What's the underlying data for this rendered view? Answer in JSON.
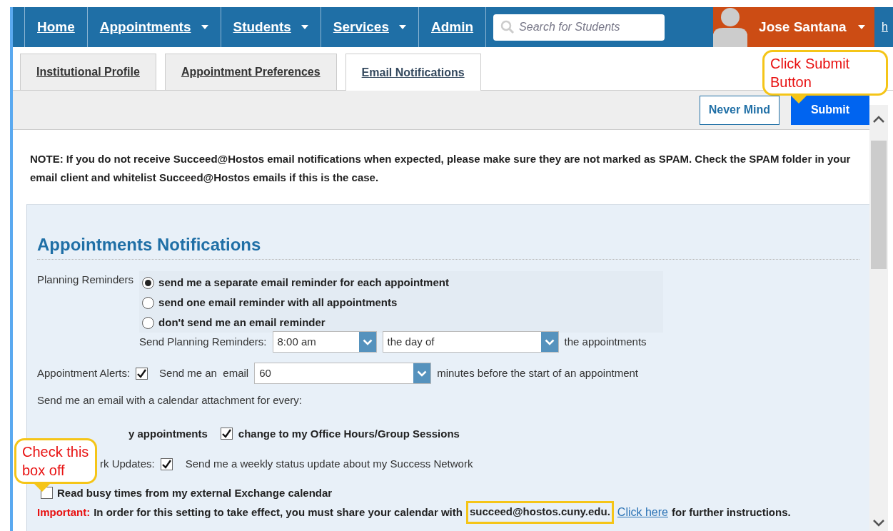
{
  "nav": {
    "items": [
      {
        "label": "Home",
        "dropdown": false
      },
      {
        "label": "Appointments",
        "dropdown": true
      },
      {
        "label": "Students",
        "dropdown": true
      },
      {
        "label": "Services",
        "dropdown": true
      },
      {
        "label": "Admin",
        "dropdown": false
      }
    ],
    "search": {
      "placeholder": "Search for Students"
    },
    "user": {
      "name": "Jose Santana"
    },
    "cut_item": "h"
  },
  "tabs": [
    {
      "label": "Institutional Profile",
      "selected": false
    },
    {
      "label": "Appointment Preferences",
      "selected": false
    },
    {
      "label": "Email Notifications",
      "selected": true
    }
  ],
  "toolbar": {
    "buttons": [
      {
        "label": "Never Mind",
        "kind": "outline"
      },
      {
        "label": "Submit",
        "kind": "primary"
      }
    ]
  },
  "note": "NOTE: If you do not receive Succeed@Hostos email notifications when expected, please make sure they are not marked as SPAM. Check the SPAM folder in your email client and whitelist Succeed@Hostos emails if this is the case.",
  "section": {
    "title": "Appointments Notifications",
    "planning": {
      "label": "Planning Reminders",
      "options": [
        {
          "label": "send me a separate email reminder for each appointment",
          "selected": true
        },
        {
          "label": "send one email reminder with all appointments",
          "selected": false
        },
        {
          "label": "don't send me an email reminder",
          "selected": false
        }
      ],
      "send_label": "Send Planning Reminders:",
      "time": "8:00 am",
      "day": "the day of",
      "suffix": "the appointments"
    },
    "alerts": {
      "label": "Appointment Alerts:",
      "checked": true,
      "text": "Send me an  email",
      "minutes": "60",
      "suffix": "minutes before the start of an appointment"
    },
    "calendar": {
      "text": "Send me an email with a calendar attachment for every:",
      "covered_label": "y appointments",
      "options": [
        {
          "label": "change to my Office Hours/Group Sessions",
          "checked": true
        }
      ]
    },
    "network": {
      "label": "rk Updates:",
      "checked": true,
      "text": "Send me a weekly status update about my Success Network"
    },
    "exchange": {
      "label": "Read busy times from my external Exchange calendar",
      "checked": false
    },
    "important": {
      "label": "Important:",
      "text": "In order for this setting to take effect, you must share your calendar with",
      "email": "succeed@hostos.cuny.edu.",
      "link": "Click here",
      "tail": "for further instructions."
    }
  },
  "annotations": [
    {
      "text": "Click Submit Button"
    },
    {
      "text": "Check this box off"
    }
  ]
}
